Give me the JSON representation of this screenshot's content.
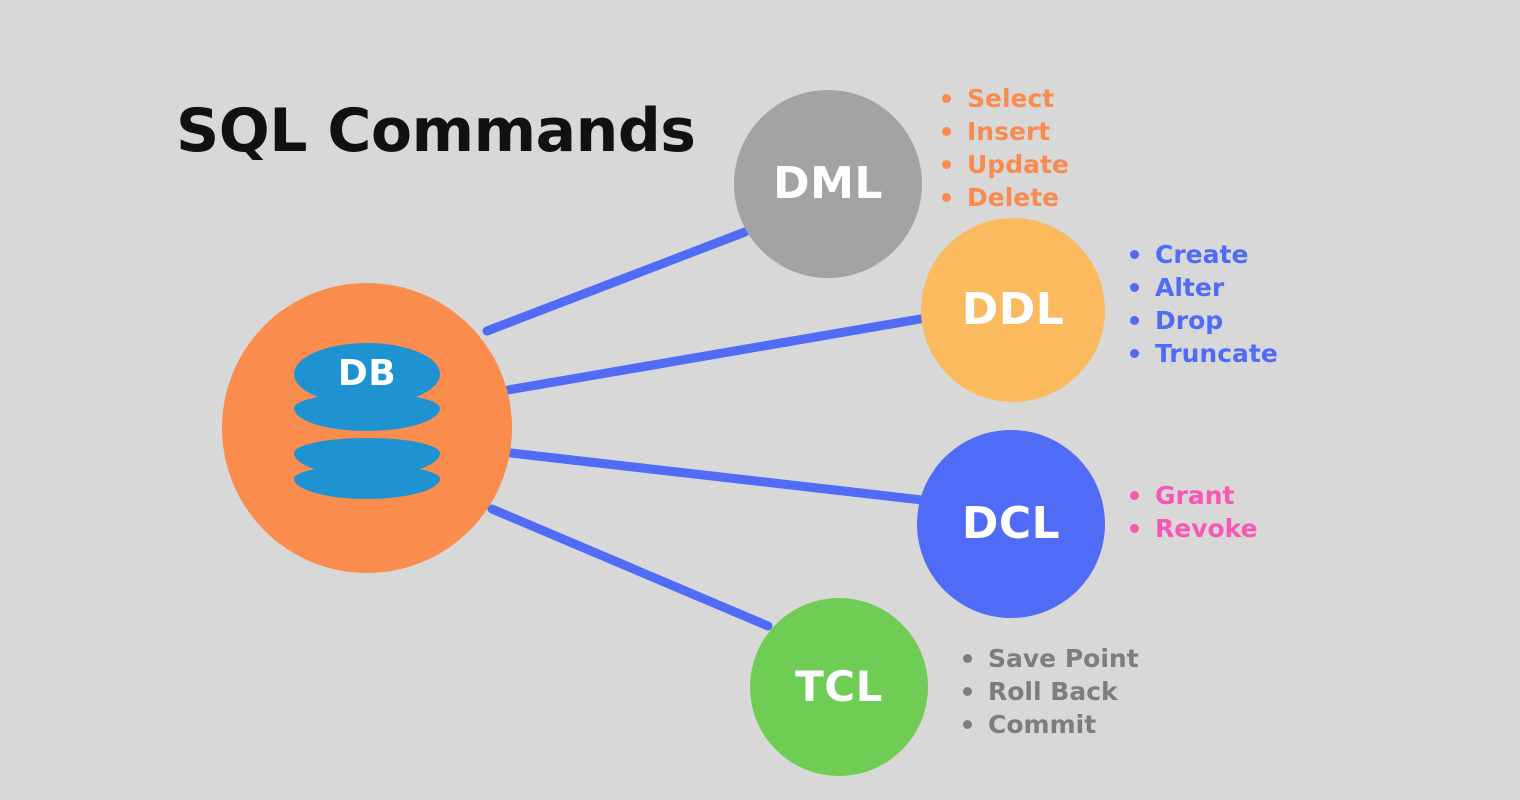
{
  "title": "SQL Commands",
  "hub": {
    "label": "DB",
    "icon": "database-cylinder-icon",
    "color": "#fa8c4e",
    "cylinder_color": "#1f93d2"
  },
  "background_color": "#d8d8d8",
  "edge_color": "#506bf5",
  "nodes": [
    {
      "id": "dml",
      "label": "DML",
      "color": "#a3a3a3",
      "text_color": "#f98b4f",
      "commands": [
        "Select",
        "Insert",
        "Update",
        "Delete"
      ]
    },
    {
      "id": "ddl",
      "label": "DDL",
      "color": "#fbba5e",
      "text_color": "#506bf5",
      "commands": [
        "Create",
        "Alter",
        "Drop",
        "Truncate"
      ]
    },
    {
      "id": "dcl",
      "label": "DCL",
      "color": "#506bf5",
      "text_color": "#f957b4",
      "commands": [
        "Grant",
        "Revoke"
      ]
    },
    {
      "id": "tcl",
      "label": "TCL",
      "color": "#6fcc54",
      "text_color": "#7d7d7d",
      "commands": [
        "Save Point",
        "Roll Back",
        "Commit"
      ]
    }
  ]
}
